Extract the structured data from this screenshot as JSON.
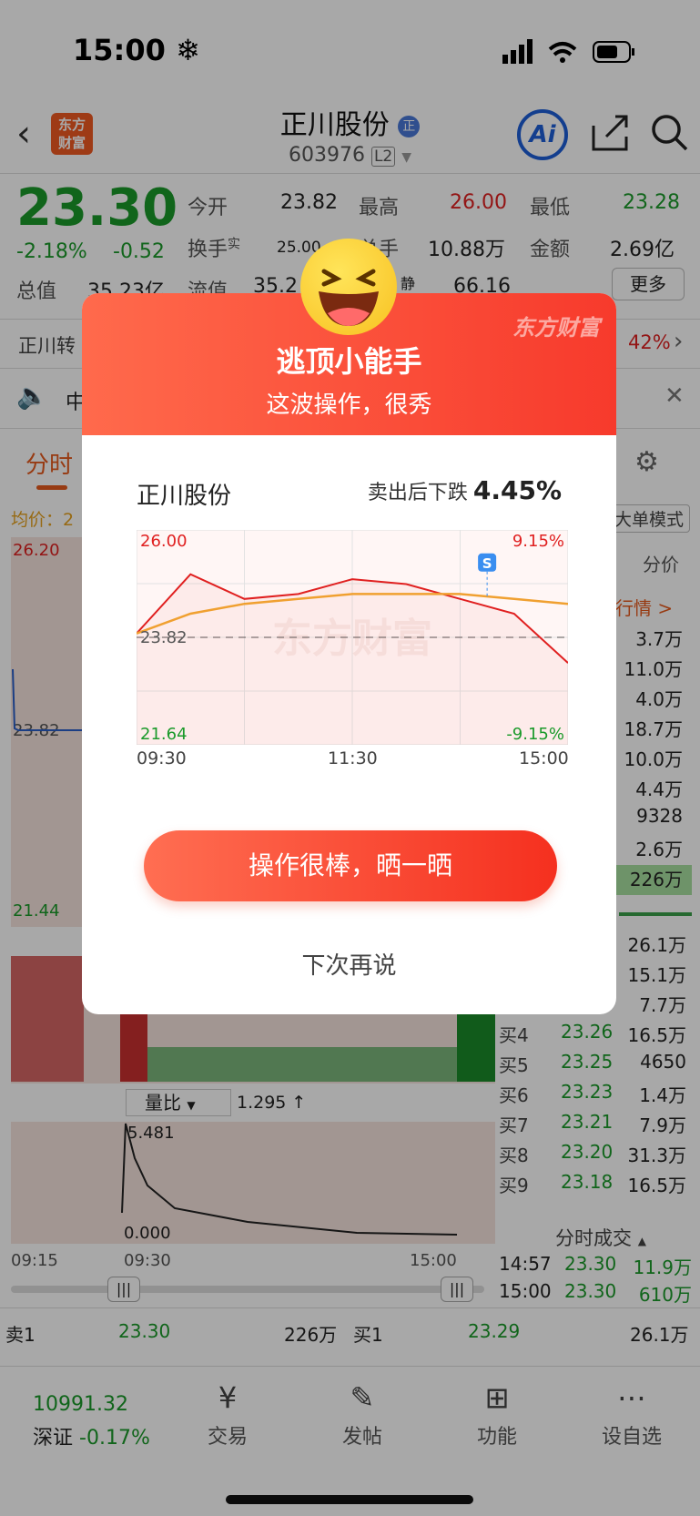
{
  "status_bar": {
    "time": "15:00",
    "weather_icon": "snowflake-icon"
  },
  "header": {
    "title": "正川股份",
    "title_badge": "正",
    "code": "603976",
    "level": "L2",
    "logo_line1": "东方",
    "logo_line2": "财富",
    "ai_label": "Ai"
  },
  "quote": {
    "price": "23.30",
    "change_pct": "-2.18%",
    "change": "-0.52",
    "open_label": "今开",
    "open": "23.82",
    "high_label": "最高",
    "high": "26.00",
    "low_label": "最低",
    "low": "23.28",
    "turnover_label": "换手",
    "turnover_sup": "实",
    "turnover": "25.00",
    "volume_label": "总手",
    "volume": "10.88万",
    "amount_label": "金额",
    "amount": "2.69亿",
    "mktcap_label": "总值",
    "mktcap": "35.23亿",
    "float_label": "流值",
    "float": "35.2",
    "pe_label": "静",
    "pe": "66.16",
    "more_label": "更多"
  },
  "banner": {
    "left_text": "正川转",
    "right_text": "42%",
    "notice_char": "中"
  },
  "chart_tabs": {
    "active": "分时",
    "avg_label": "均价：2",
    "mode_label": "大单模式",
    "price_level_label": "分价",
    "quote_link": "行情 >"
  },
  "main_chart_labels": {
    "top": "26.20",
    "mid": "23.82",
    "bottom": "21.44"
  },
  "sell_levels": [
    "3.7万",
    "11.0万",
    "4.0万",
    "18.7万",
    "10.0万",
    "4.4万",
    "9328",
    "2.6万",
    "226万"
  ],
  "buy_levels": [
    {
      "label": "",
      "price": "",
      "vol": "26.1万"
    },
    {
      "label": "",
      "price": "",
      "vol": "15.1万"
    },
    {
      "label": "",
      "price": "",
      "vol": "7.7万"
    },
    {
      "label": "买4",
      "price": "23.26",
      "vol": "16.5万"
    },
    {
      "label": "买5",
      "price": "23.25",
      "vol": "4650"
    },
    {
      "label": "买6",
      "price": "23.23",
      "vol": "1.4万"
    },
    {
      "label": "买7",
      "price": "23.21",
      "vol": "7.9万"
    },
    {
      "label": "买8",
      "price": "23.20",
      "vol": "31.3万"
    },
    {
      "label": "买9",
      "price": "23.18",
      "vol": "16.5万"
    }
  ],
  "ratio_panel": {
    "label": "量比",
    "value": "1.295 ↑",
    "max": "5.481",
    "min": "0.000"
  },
  "time_axis": [
    "09:15",
    "09:30",
    "15:00"
  ],
  "tick_section": {
    "title": "分时成交",
    "rows": [
      {
        "time": "14:57",
        "price": "23.30",
        "vol": "11.9万"
      },
      {
        "time": "15:00",
        "price": "23.30",
        "vol": "610万"
      }
    ]
  },
  "bottom_quote": {
    "sell1_label": "卖1",
    "sell1_price": "23.30",
    "sell1_vol": "226万",
    "buy1_label": "买1",
    "buy1_price": "23.29",
    "buy1_vol": "26.1万"
  },
  "index": {
    "value": "10991.32",
    "name": "深证",
    "change": "-0.17%"
  },
  "tabbar": [
    {
      "label": "交易",
      "icon": "yen-trade-icon"
    },
    {
      "label": "发帖",
      "icon": "edit-post-icon"
    },
    {
      "label": "功能",
      "icon": "grid-apps-icon"
    },
    {
      "label": "设自选",
      "icon": "more-dots-icon"
    }
  ],
  "modal": {
    "title": "逃顶小能手",
    "subtitle": "这波操作，很秀",
    "brand": "东方财富",
    "stock_name": "正川股份",
    "drop_text": "卖出后下跌",
    "drop_value": "4.45%",
    "share_button": "操作很棒，晒一晒",
    "later_button": "下次再说",
    "chart": {
      "y_top": "26.00",
      "y_ref": "23.82",
      "y_bottom": "21.64",
      "pct_top": "9.15%",
      "pct_bottom": "-9.15%",
      "x_labels": [
        "09:30",
        "11:30",
        "15:00"
      ],
      "sell_marker": "S",
      "watermark": "东方财富"
    }
  },
  "chart_data": {
    "type": "line",
    "title": "",
    "x": [
      "09:30",
      "10:00",
      "10:30",
      "11:00",
      "11:30",
      "13:30",
      "14:00",
      "14:30",
      "15:00"
    ],
    "series": [
      {
        "name": "",
        "values": [
          23.9,
          25.1,
          24.6,
          24.7,
          25.0,
          24.9,
          24.6,
          24.3,
          23.3
        ]
      },
      {
        "name": "",
        "values": [
          23.9,
          24.3,
          24.5,
          24.6,
          24.7,
          24.7,
          24.7,
          24.6,
          24.5
        ]
      }
    ],
    "ylim": [
      21.64,
      26.0
    ],
    "reference": 23.82,
    "xlabel": "",
    "ylabel": ""
  }
}
